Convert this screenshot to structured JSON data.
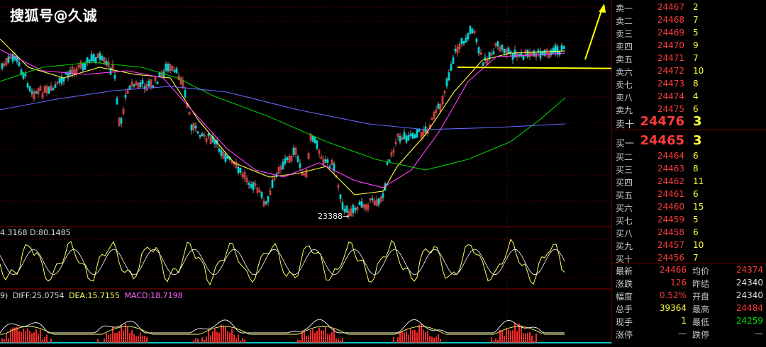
{
  "watermark": "搜狐号@久诚",
  "low_marker": "23388",
  "kdj_text": "4.3168  D:80.1485",
  "macd_text": {
    "prefix": "9)",
    "diff": "DIFF:25.0754",
    "dea": "DEA:15.7155",
    "macd": "MACD:18.7198"
  },
  "colors": {
    "up": "#ff3b3b",
    "down": "#00d4d4",
    "ma5": "#ffffff",
    "ma10": "#ffff44",
    "ma20": "#ff40ff",
    "ma60": "#00cc00",
    "ma120": "#6666ff",
    "arrow": "#ffff00",
    "macd_up": "#ff2a2a",
    "macd_dn": "#00c8c8"
  },
  "sells": [
    {
      "label": "卖十",
      "price": "24476",
      "vol": "3"
    },
    {
      "label": "卖九",
      "price": "24475",
      "vol": "6"
    },
    {
      "label": "卖八",
      "price": "24474",
      "vol": "4"
    },
    {
      "label": "卖七",
      "price": "24473",
      "vol": "8"
    },
    {
      "label": "卖六",
      "price": "24472",
      "vol": "10"
    },
    {
      "label": "卖五",
      "price": "24471",
      "vol": "7"
    },
    {
      "label": "卖四",
      "price": "24470",
      "vol": "9"
    },
    {
      "label": "卖三",
      "price": "24469",
      "vol": "5"
    },
    {
      "label": "卖二",
      "price": "24468",
      "vol": "7"
    },
    {
      "label": "卖一",
      "price": "24467",
      "vol": "2"
    }
  ],
  "buys": [
    {
      "label": "买一",
      "price": "24465",
      "vol": "3"
    },
    {
      "label": "买二",
      "price": "24464",
      "vol": "6"
    },
    {
      "label": "买三",
      "price": "24463",
      "vol": "8"
    },
    {
      "label": "买四",
      "price": "24462",
      "vol": "11"
    },
    {
      "label": "买五",
      "price": "24461",
      "vol": "6"
    },
    {
      "label": "买六",
      "price": "24460",
      "vol": "15"
    },
    {
      "label": "买七",
      "price": "24459",
      "vol": "5"
    },
    {
      "label": "买八",
      "price": "24458",
      "vol": "6"
    },
    {
      "label": "买九",
      "price": "24457",
      "vol": "10"
    },
    {
      "label": "买十",
      "price": "24456",
      "vol": "7"
    }
  ],
  "stats": [
    {
      "l_label": "最新",
      "l_value": "24466",
      "l_color": "#ff3b3b",
      "r_label": "均价",
      "r_value": "24374",
      "r_color": "#ff3b3b"
    },
    {
      "l_label": "涨跌",
      "l_value": "126",
      "l_color": "#ff3b3b",
      "r_label": "昨结",
      "r_value": "24340",
      "r_color": "#e0e0e0"
    },
    {
      "l_label": "幅度",
      "l_value": "0.52%",
      "l_color": "#ff3b3b",
      "r_label": "开盘",
      "r_value": "24340",
      "r_color": "#e0e0e0"
    },
    {
      "l_label": "总手",
      "l_value": "39364",
      "l_color": "#ffff44",
      "r_label": "最高",
      "r_value": "24484",
      "r_color": "#ff3b3b"
    },
    {
      "l_label": "现手",
      "l_value": "1",
      "l_color": "#ffff44",
      "r_label": "最低",
      "r_value": "24259",
      "r_color": "#00e000"
    },
    {
      "l_label": "涨停",
      "l_value": "—",
      "l_color": "#c8c8c8",
      "r_label": "跌停",
      "r_value": "—",
      "r_color": "#c8c8c8"
    }
  ]
}
